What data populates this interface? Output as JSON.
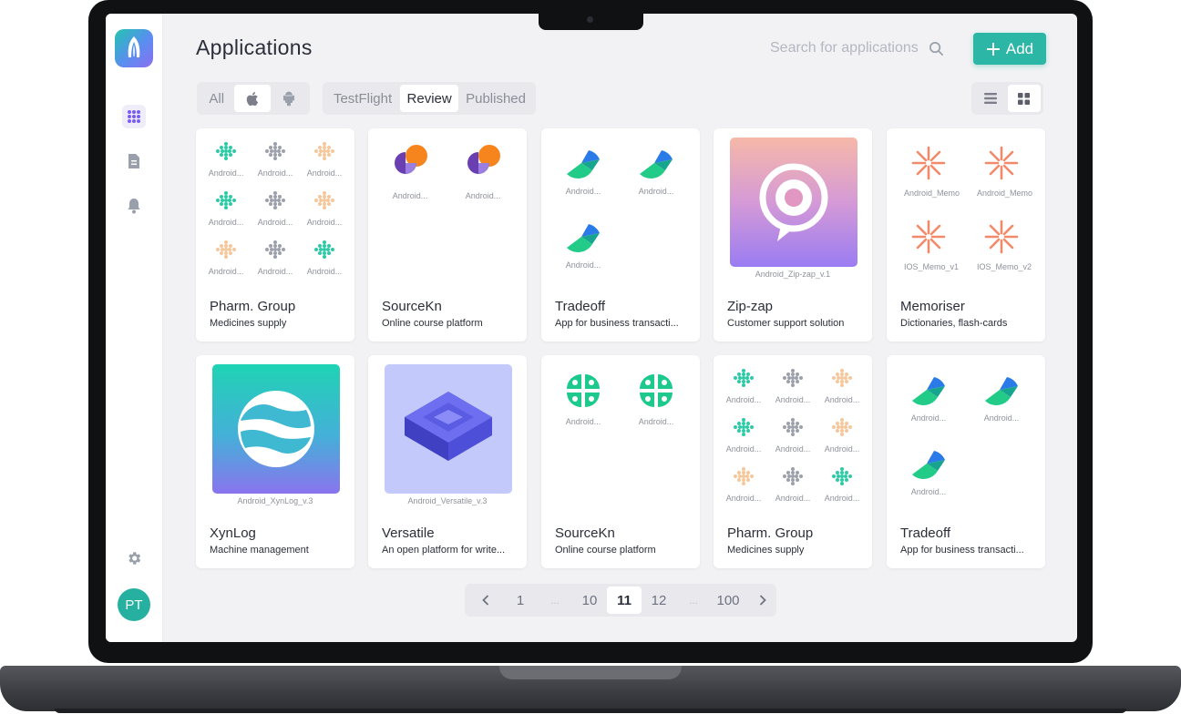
{
  "app": {
    "title": "Applications",
    "avatar_initials": "PT"
  },
  "search": {
    "placeholder": "Search for applications"
  },
  "add_button": {
    "label": "Add"
  },
  "platform_filter": {
    "all_label": "All",
    "selected": "ios"
  },
  "status_tabs": [
    "TestFlight",
    "Review",
    "Published"
  ],
  "status_selected": "Review",
  "view_mode": "grid",
  "sidebar": {
    "items": [
      "apps-grid-icon",
      "document-icon",
      "bell-icon",
      "gear-icon"
    ],
    "active": "apps-grid-icon"
  },
  "cards": [
    {
      "name": "Pharm. Group",
      "desc": "Medicines supply",
      "builds": [
        "Android...",
        "Android...",
        "Android...",
        "Android...",
        "Android...",
        "Android...",
        "Android...",
        "Android...",
        "Android..."
      ]
    },
    {
      "name": "SourceKn",
      "desc": "Online course platform",
      "builds": [
        "Android...",
        "Android..."
      ]
    },
    {
      "name": "Tradeoff",
      "desc": "App for business transacti...",
      "builds": [
        "Android...",
        "Android...",
        "Android..."
      ]
    },
    {
      "name": "Zip-zap",
      "desc": "Customer support solution",
      "builds": [
        "Android_Zip-zap_v.1"
      ]
    },
    {
      "name": "Memoriser",
      "desc": "Dictionaries, flash-cards",
      "builds": [
        "Android_Memo",
        "Android_Memo",
        "IOS_Memo_v1",
        "IOS_Memo_v2"
      ]
    },
    {
      "name": "XynLog",
      "desc": "Machine management",
      "builds": [
        "Android_XynLog_v.3"
      ]
    },
    {
      "name": "Versatile",
      "desc": "An open platform for write...",
      "builds": [
        "Android_Versatile_v.3"
      ]
    },
    {
      "name": "SourceKn",
      "desc": "Online course platform",
      "builds": [
        "Android...",
        "Android..."
      ]
    },
    {
      "name": "Pharm. Group",
      "desc": "Medicines supply",
      "builds": [
        "Android...",
        "Android...",
        "Android...",
        "Android...",
        "Android...",
        "Android...",
        "Android...",
        "Android...",
        "Android..."
      ]
    },
    {
      "name": "Tradeoff",
      "desc": "App for business transacti...",
      "builds": [
        "Android...",
        "Android...",
        "Android..."
      ]
    }
  ],
  "pagination": {
    "pages": [
      "1",
      "...",
      "10",
      "11",
      "12",
      "...",
      "100"
    ],
    "current": "11"
  },
  "colors": {
    "accent": "#2bb6a5",
    "text": "#2b2e3a",
    "muted": "#8a8d98"
  }
}
